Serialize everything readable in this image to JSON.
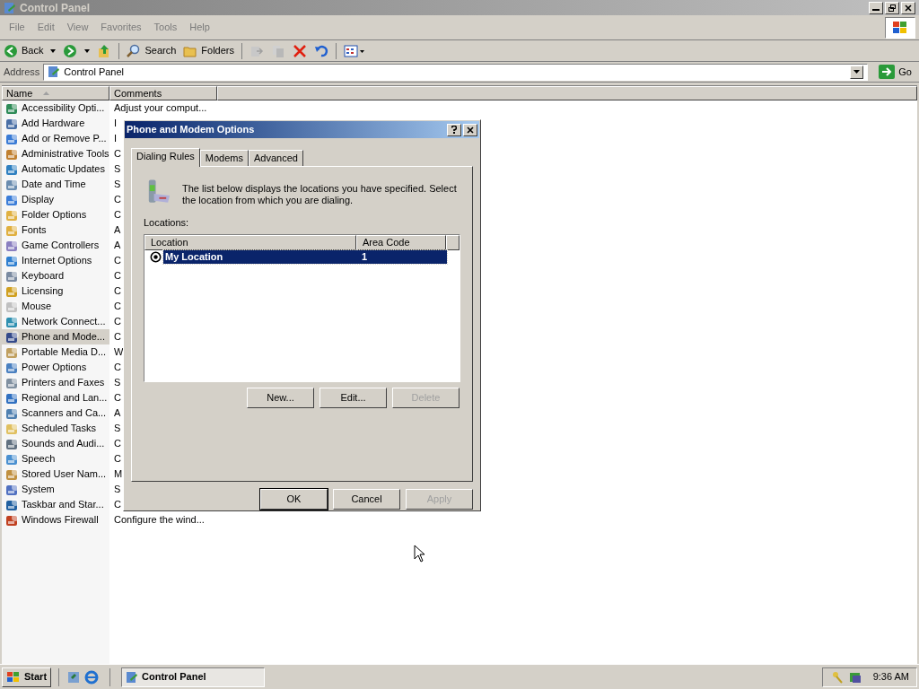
{
  "window": {
    "title": "Control Panel"
  },
  "menu_bar": [
    {
      "label": "File",
      "disabled": false
    },
    {
      "label": "Edit",
      "disabled": false
    },
    {
      "label": "View",
      "disabled": false
    },
    {
      "label": "Favorites",
      "disabled": false
    },
    {
      "label": "Tools",
      "disabled": false
    },
    {
      "label": "Help",
      "disabled": false
    }
  ],
  "toolbar": {
    "back": "Back",
    "search": "Search",
    "folders": "Folders"
  },
  "address_bar": {
    "label": "Address",
    "value": "Control Panel",
    "go": "Go"
  },
  "list": {
    "columns": [
      {
        "label": "Name",
        "sorted": true
      },
      {
        "label": "Comments",
        "sorted": false
      }
    ],
    "rows": [
      {
        "name": "Accessibility Opti...",
        "comment": "Adjust your comput...",
        "selected": false
      },
      {
        "name": "Add Hardware",
        "comment": "I",
        "selected": false
      },
      {
        "name": "Add or Remove P...",
        "comment": "I",
        "selected": false
      },
      {
        "name": "Administrative Tools",
        "comment": "C",
        "selected": false
      },
      {
        "name": "Automatic Updates",
        "comment": "S",
        "selected": false
      },
      {
        "name": "Date and Time",
        "comment": "S",
        "selected": false
      },
      {
        "name": "Display",
        "comment": "C",
        "selected": false
      },
      {
        "name": "Folder Options",
        "comment": "C",
        "selected": false
      },
      {
        "name": "Fonts",
        "comment": "A",
        "selected": false
      },
      {
        "name": "Game Controllers",
        "comment": "A",
        "selected": false
      },
      {
        "name": "Internet Options",
        "comment": "C",
        "selected": false
      },
      {
        "name": "Keyboard",
        "comment": "C",
        "selected": false
      },
      {
        "name": "Licensing",
        "comment": "C",
        "selected": false
      },
      {
        "name": "Mouse",
        "comment": "C",
        "selected": false
      },
      {
        "name": "Network Connect...",
        "comment": "C",
        "selected": false
      },
      {
        "name": "Phone and Mode...",
        "comment": "C",
        "selected": true
      },
      {
        "name": "Portable Media D...",
        "comment": "W",
        "selected": false
      },
      {
        "name": "Power Options",
        "comment": "C",
        "selected": false
      },
      {
        "name": "Printers and Faxes",
        "comment": "S",
        "selected": false
      },
      {
        "name": "Regional and Lan...",
        "comment": "C",
        "selected": false
      },
      {
        "name": "Scanners and Ca...",
        "comment": "A",
        "selected": false
      },
      {
        "name": "Scheduled Tasks",
        "comment": "S",
        "selected": false
      },
      {
        "name": "Sounds and Audi...",
        "comment": "C",
        "selected": false
      },
      {
        "name": "Speech",
        "comment": "C",
        "selected": false
      },
      {
        "name": "Stored User Nam...",
        "comment": "M",
        "selected": false
      },
      {
        "name": "System",
        "comment": "S",
        "selected": false
      },
      {
        "name": "Taskbar and Star...",
        "comment": "C",
        "selected": false
      },
      {
        "name": "Windows Firewall",
        "comment": "Configure the wind...",
        "selected": false
      }
    ]
  },
  "dialog": {
    "title": "Phone and Modem Options",
    "tabs": [
      {
        "label": "Dialing Rules",
        "selected": true
      },
      {
        "label": "Modems",
        "selected": false
      },
      {
        "label": "Advanced",
        "selected": false
      }
    ],
    "description": "The list below displays the locations you have specified. Select the location from which you are dialing.",
    "locations_label": "Locations:",
    "table": {
      "columns": [
        "Location",
        "Area Code"
      ],
      "rows": [
        {
          "location": "My Location",
          "area_code": "1",
          "selected": true
        }
      ]
    },
    "actions": [
      {
        "label": "New...",
        "disabled": false
      },
      {
        "label": "Edit...",
        "disabled": false
      },
      {
        "label": "Delete",
        "disabled": true
      }
    ],
    "footer_buttons": [
      {
        "label": "OK",
        "disabled": false,
        "default": true
      },
      {
        "label": "Cancel",
        "disabled": false,
        "default": false
      },
      {
        "label": "Apply",
        "disabled": true,
        "default": false
      }
    ]
  },
  "taskbar": {
    "start": "Start",
    "tasks": [
      {
        "label": "Control Panel",
        "selected": true
      }
    ],
    "clock": "9:36 AM"
  }
}
